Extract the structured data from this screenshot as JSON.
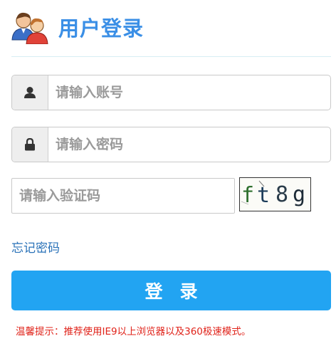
{
  "header": {
    "title": "用户登录",
    "logo_icon": "users-icon"
  },
  "account": {
    "placeholder": "请输入账号",
    "icon": "user-icon"
  },
  "password": {
    "placeholder": "请输入密码",
    "icon": "lock-icon"
  },
  "captcha": {
    "placeholder": "请输入验证码",
    "code": "ft8g"
  },
  "forgot_label": "忘记密码",
  "login_label": "登录",
  "tip": "温馨提示：推荐使用IE9以上浏览器以及360极速模式。",
  "colors": {
    "title": "#3b8fe6",
    "button": "#22a4f2",
    "tip": "#e0231a",
    "link": "#2a72b8"
  }
}
